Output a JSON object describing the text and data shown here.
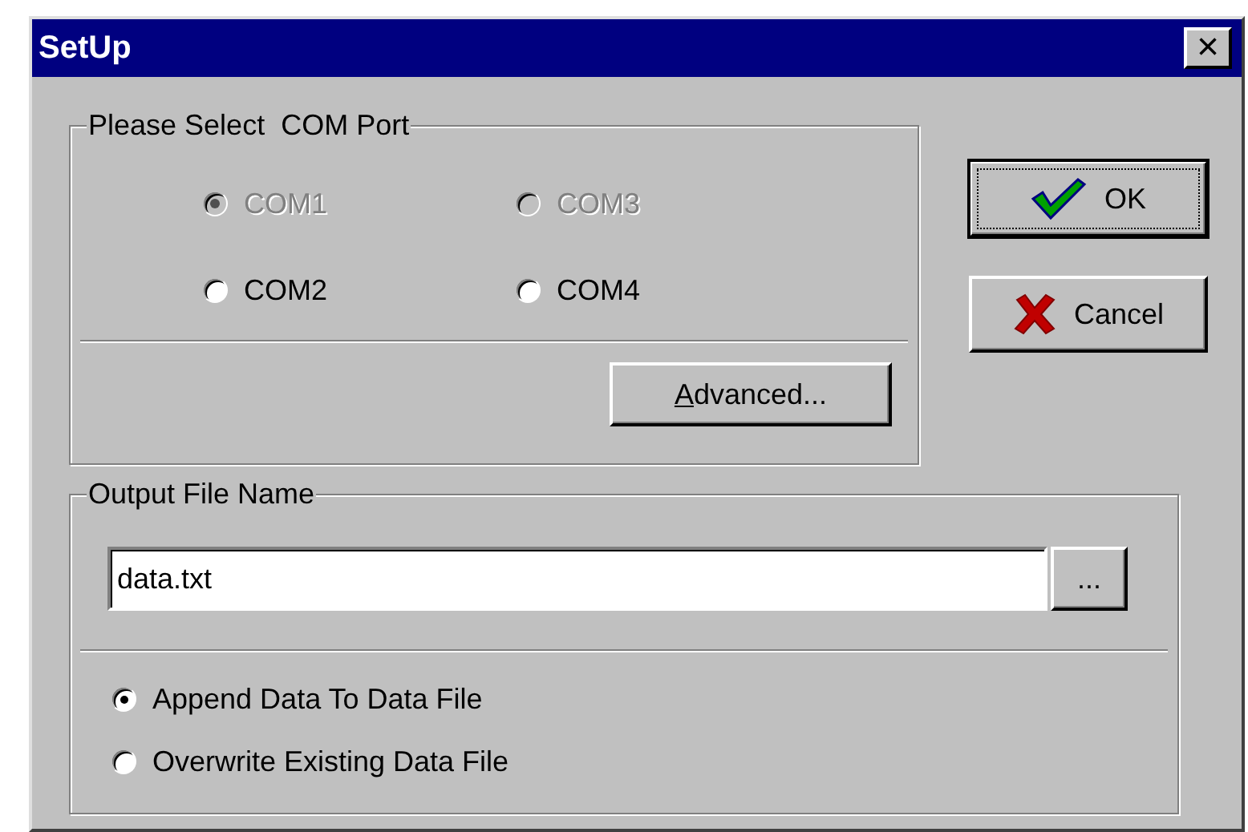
{
  "window": {
    "title": "SetUp",
    "close": "×"
  },
  "com_group": {
    "title": "Please Select  COM Port",
    "ports": [
      {
        "label": "COM1",
        "selected": true,
        "disabled": true
      },
      {
        "label": "COM3",
        "selected": false,
        "disabled": true
      },
      {
        "label": "COM2",
        "selected": false,
        "disabled": false
      },
      {
        "label": "COM4",
        "selected": false,
        "disabled": false
      }
    ],
    "advanced": "Advanced..."
  },
  "buttons": [
    {
      "label": "OK",
      "kind": "ok",
      "default": true
    },
    {
      "label": "Cancel",
      "kind": "cancel",
      "default": false
    }
  ],
  "output_group": {
    "title": "Output File Name",
    "file_name": "data.txt",
    "browse": "...",
    "modes": [
      {
        "label": "Append Data To Data File",
        "selected": true
      },
      {
        "label": "Overwrite Existing Data File",
        "selected": false
      }
    ]
  }
}
